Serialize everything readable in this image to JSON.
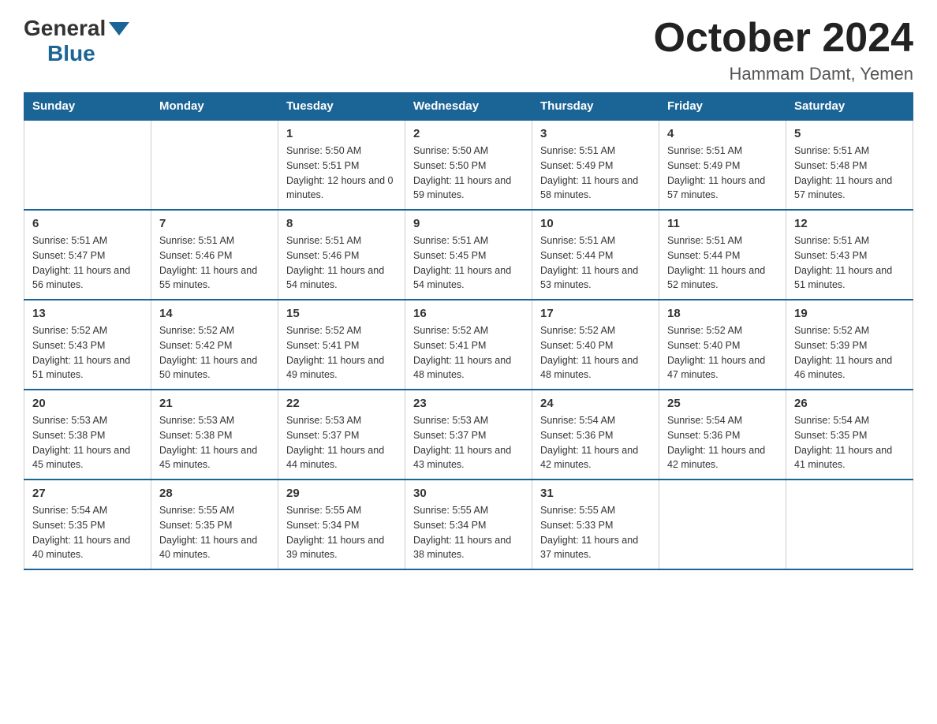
{
  "logo": {
    "general": "General",
    "triangle_color": "#1a6496",
    "blue": "Blue"
  },
  "title": {
    "month_year": "October 2024",
    "location": "Hammam Damt, Yemen"
  },
  "days_of_week": [
    "Sunday",
    "Monday",
    "Tuesday",
    "Wednesday",
    "Thursday",
    "Friday",
    "Saturday"
  ],
  "weeks": [
    [
      {
        "day": "",
        "sunrise": "",
        "sunset": "",
        "daylight": ""
      },
      {
        "day": "",
        "sunrise": "",
        "sunset": "",
        "daylight": ""
      },
      {
        "day": "1",
        "sunrise": "Sunrise: 5:50 AM",
        "sunset": "Sunset: 5:51 PM",
        "daylight": "Daylight: 12 hours and 0 minutes."
      },
      {
        "day": "2",
        "sunrise": "Sunrise: 5:50 AM",
        "sunset": "Sunset: 5:50 PM",
        "daylight": "Daylight: 11 hours and 59 minutes."
      },
      {
        "day": "3",
        "sunrise": "Sunrise: 5:51 AM",
        "sunset": "Sunset: 5:49 PM",
        "daylight": "Daylight: 11 hours and 58 minutes."
      },
      {
        "day": "4",
        "sunrise": "Sunrise: 5:51 AM",
        "sunset": "Sunset: 5:49 PM",
        "daylight": "Daylight: 11 hours and 57 minutes."
      },
      {
        "day": "5",
        "sunrise": "Sunrise: 5:51 AM",
        "sunset": "Sunset: 5:48 PM",
        "daylight": "Daylight: 11 hours and 57 minutes."
      }
    ],
    [
      {
        "day": "6",
        "sunrise": "Sunrise: 5:51 AM",
        "sunset": "Sunset: 5:47 PM",
        "daylight": "Daylight: 11 hours and 56 minutes."
      },
      {
        "day": "7",
        "sunrise": "Sunrise: 5:51 AM",
        "sunset": "Sunset: 5:46 PM",
        "daylight": "Daylight: 11 hours and 55 minutes."
      },
      {
        "day": "8",
        "sunrise": "Sunrise: 5:51 AM",
        "sunset": "Sunset: 5:46 PM",
        "daylight": "Daylight: 11 hours and 54 minutes."
      },
      {
        "day": "9",
        "sunrise": "Sunrise: 5:51 AM",
        "sunset": "Sunset: 5:45 PM",
        "daylight": "Daylight: 11 hours and 54 minutes."
      },
      {
        "day": "10",
        "sunrise": "Sunrise: 5:51 AM",
        "sunset": "Sunset: 5:44 PM",
        "daylight": "Daylight: 11 hours and 53 minutes."
      },
      {
        "day": "11",
        "sunrise": "Sunrise: 5:51 AM",
        "sunset": "Sunset: 5:44 PM",
        "daylight": "Daylight: 11 hours and 52 minutes."
      },
      {
        "day": "12",
        "sunrise": "Sunrise: 5:51 AM",
        "sunset": "Sunset: 5:43 PM",
        "daylight": "Daylight: 11 hours and 51 minutes."
      }
    ],
    [
      {
        "day": "13",
        "sunrise": "Sunrise: 5:52 AM",
        "sunset": "Sunset: 5:43 PM",
        "daylight": "Daylight: 11 hours and 51 minutes."
      },
      {
        "day": "14",
        "sunrise": "Sunrise: 5:52 AM",
        "sunset": "Sunset: 5:42 PM",
        "daylight": "Daylight: 11 hours and 50 minutes."
      },
      {
        "day": "15",
        "sunrise": "Sunrise: 5:52 AM",
        "sunset": "Sunset: 5:41 PM",
        "daylight": "Daylight: 11 hours and 49 minutes."
      },
      {
        "day": "16",
        "sunrise": "Sunrise: 5:52 AM",
        "sunset": "Sunset: 5:41 PM",
        "daylight": "Daylight: 11 hours and 48 minutes."
      },
      {
        "day": "17",
        "sunrise": "Sunrise: 5:52 AM",
        "sunset": "Sunset: 5:40 PM",
        "daylight": "Daylight: 11 hours and 48 minutes."
      },
      {
        "day": "18",
        "sunrise": "Sunrise: 5:52 AM",
        "sunset": "Sunset: 5:40 PM",
        "daylight": "Daylight: 11 hours and 47 minutes."
      },
      {
        "day": "19",
        "sunrise": "Sunrise: 5:52 AM",
        "sunset": "Sunset: 5:39 PM",
        "daylight": "Daylight: 11 hours and 46 minutes."
      }
    ],
    [
      {
        "day": "20",
        "sunrise": "Sunrise: 5:53 AM",
        "sunset": "Sunset: 5:38 PM",
        "daylight": "Daylight: 11 hours and 45 minutes."
      },
      {
        "day": "21",
        "sunrise": "Sunrise: 5:53 AM",
        "sunset": "Sunset: 5:38 PM",
        "daylight": "Daylight: 11 hours and 45 minutes."
      },
      {
        "day": "22",
        "sunrise": "Sunrise: 5:53 AM",
        "sunset": "Sunset: 5:37 PM",
        "daylight": "Daylight: 11 hours and 44 minutes."
      },
      {
        "day": "23",
        "sunrise": "Sunrise: 5:53 AM",
        "sunset": "Sunset: 5:37 PM",
        "daylight": "Daylight: 11 hours and 43 minutes."
      },
      {
        "day": "24",
        "sunrise": "Sunrise: 5:54 AM",
        "sunset": "Sunset: 5:36 PM",
        "daylight": "Daylight: 11 hours and 42 minutes."
      },
      {
        "day": "25",
        "sunrise": "Sunrise: 5:54 AM",
        "sunset": "Sunset: 5:36 PM",
        "daylight": "Daylight: 11 hours and 42 minutes."
      },
      {
        "day": "26",
        "sunrise": "Sunrise: 5:54 AM",
        "sunset": "Sunset: 5:35 PM",
        "daylight": "Daylight: 11 hours and 41 minutes."
      }
    ],
    [
      {
        "day": "27",
        "sunrise": "Sunrise: 5:54 AM",
        "sunset": "Sunset: 5:35 PM",
        "daylight": "Daylight: 11 hours and 40 minutes."
      },
      {
        "day": "28",
        "sunrise": "Sunrise: 5:55 AM",
        "sunset": "Sunset: 5:35 PM",
        "daylight": "Daylight: 11 hours and 40 minutes."
      },
      {
        "day": "29",
        "sunrise": "Sunrise: 5:55 AM",
        "sunset": "Sunset: 5:34 PM",
        "daylight": "Daylight: 11 hours and 39 minutes."
      },
      {
        "day": "30",
        "sunrise": "Sunrise: 5:55 AM",
        "sunset": "Sunset: 5:34 PM",
        "daylight": "Daylight: 11 hours and 38 minutes."
      },
      {
        "day": "31",
        "sunrise": "Sunrise: 5:55 AM",
        "sunset": "Sunset: 5:33 PM",
        "daylight": "Daylight: 11 hours and 37 minutes."
      },
      {
        "day": "",
        "sunrise": "",
        "sunset": "",
        "daylight": ""
      },
      {
        "day": "",
        "sunrise": "",
        "sunset": "",
        "daylight": ""
      }
    ]
  ]
}
